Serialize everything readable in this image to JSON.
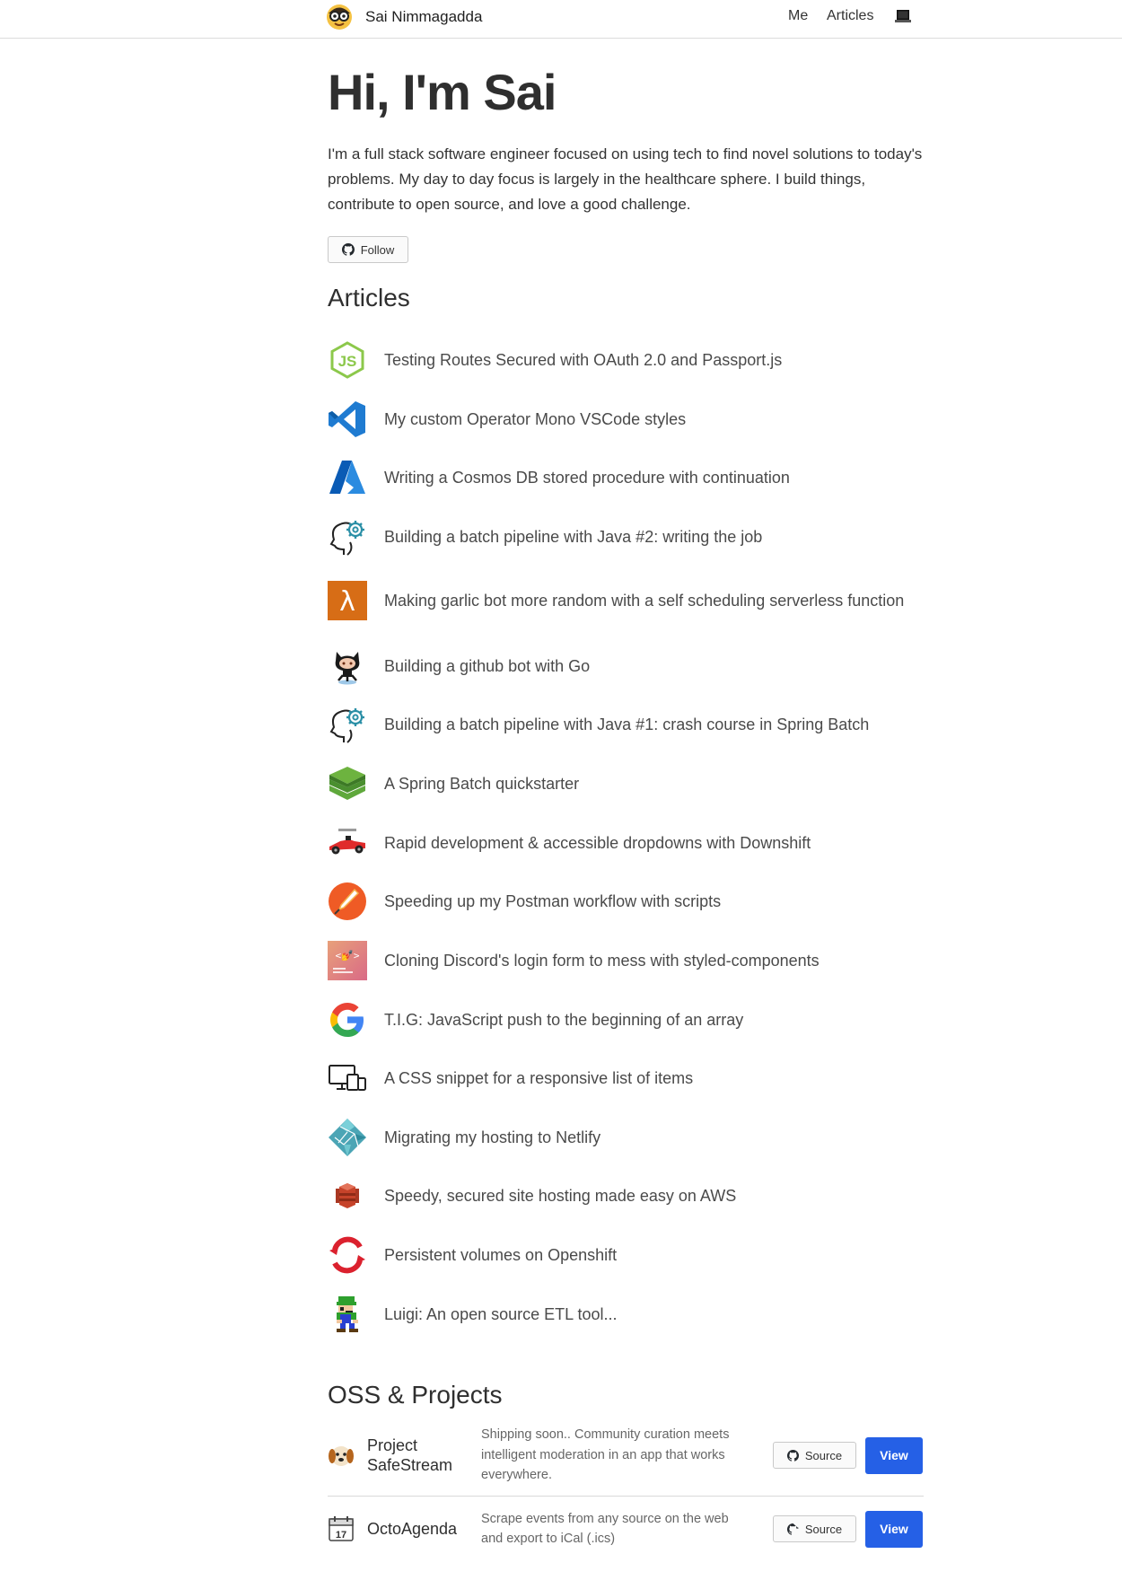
{
  "header": {
    "site_name": "Sai Nimmagadda",
    "nav": {
      "me": "Me",
      "articles": "Articles"
    }
  },
  "hero": {
    "title": "Hi, I'm Sai",
    "intro": "I'm a full stack software engineer focused on using tech to find novel solutions to today's problems. My day to day focus is largely in the healthcare sphere. I build things, contribute to open source, and love a good challenge.",
    "follow_label": "Follow"
  },
  "articles": {
    "heading": "Articles",
    "items": [
      {
        "title": "Testing Routes Secured with OAuth 2.0 and Passport.js",
        "icon": "nodejs-icon"
      },
      {
        "title": "My custom Operator Mono VSCode styles",
        "icon": "vscode-icon"
      },
      {
        "title": "Writing a Cosmos DB stored procedure with continuation",
        "icon": "azure-icon"
      },
      {
        "title": "Building a batch pipeline with Java #2: writing the job",
        "icon": "head-gear-icon"
      },
      {
        "title": "Making garlic bot more random with a self scheduling serverless function",
        "icon": "aws-lambda-icon"
      },
      {
        "title": "Building a github bot with Go",
        "icon": "octocat-icon"
      },
      {
        "title": "Building a batch pipeline with Java #1: crash course in Spring Batch",
        "icon": "head-gear-icon"
      },
      {
        "title": "A Spring Batch quickstarter",
        "icon": "spring-batch-icon"
      },
      {
        "title": "Rapid development & accessible dropdowns with Downshift",
        "icon": "race-car-icon"
      },
      {
        "title": "Speeding up my Postman workflow with scripts",
        "icon": "postman-icon"
      },
      {
        "title": "Cloning Discord's login form to mess with styled-components",
        "icon": "styled-components-icon"
      },
      {
        "title": "T.I.G: JavaScript push to the beginning of an array",
        "icon": "google-icon"
      },
      {
        "title": "A CSS snippet for a responsive list of items",
        "icon": "devices-icon"
      },
      {
        "title": "Migrating my hosting to Netlify",
        "icon": "netlify-icon"
      },
      {
        "title": "Speedy, secured site hosting made easy on AWS",
        "icon": "aws-icon"
      },
      {
        "title": "Persistent volumes on Openshift",
        "icon": "openshift-icon"
      },
      {
        "title": "Luigi: An open source ETL tool...",
        "icon": "luigi-icon"
      }
    ]
  },
  "oss": {
    "heading": "OSS & Projects",
    "projects": [
      {
        "name": "Project SafeStream",
        "description": "Shipping soon.. Community curation meets intelligent moderation in an app that works everywhere.",
        "source_label": "Source",
        "view_label": "View",
        "icon": "dog-icon"
      },
      {
        "name": "OctoAgenda",
        "description": "Scrape events from any source on the web and export to iCal (.ics)",
        "source_label": "Source",
        "view_label": "View",
        "icon": "calendar-icon",
        "calendar_day": "17"
      }
    ]
  }
}
